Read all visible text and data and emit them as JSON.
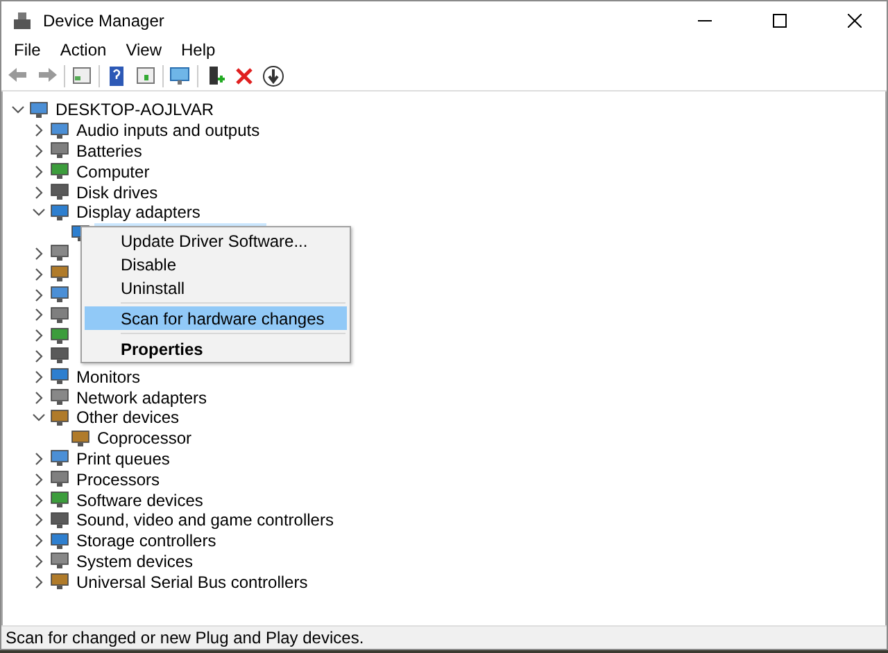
{
  "window": {
    "title": "Device Manager"
  },
  "menu_bar": [
    "File",
    "Action",
    "View",
    "Help"
  ],
  "tree": {
    "label": "DESKTOP-AOJLVAR",
    "expanded": true,
    "children": [
      {
        "label": "Audio inputs and outputs",
        "expanded": false
      },
      {
        "label": "Batteries",
        "expanded": false
      },
      {
        "label": "Computer",
        "expanded": false
      },
      {
        "label": "Disk drives",
        "expanded": false
      },
      {
        "label": "Display adapters",
        "expanded": true,
        "children": [
          {
            "selected": true
          }
        ]
      },
      {
        "expanded": false
      },
      {
        "expanded": false
      },
      {
        "expanded": false
      },
      {
        "expanded": false
      },
      {
        "expanded": false
      },
      {
        "expanded": false
      },
      {
        "label": "Monitors",
        "expanded": false
      },
      {
        "label": "Network adapters",
        "expanded": false
      },
      {
        "label": "Other devices",
        "expanded": true,
        "children": [
          {
            "label": "Coprocessor",
            "selected": false
          }
        ]
      },
      {
        "label": "Print queues",
        "expanded": false
      },
      {
        "label": "Processors",
        "expanded": false
      },
      {
        "label": "Software devices",
        "expanded": false
      },
      {
        "label": "Sound, video and game controllers",
        "expanded": false
      },
      {
        "label": "Storage controllers",
        "expanded": false
      },
      {
        "label": "System devices",
        "expanded": false
      },
      {
        "label": "Universal Serial Bus controllers",
        "expanded": false
      }
    ]
  },
  "context_menu": [
    {
      "kind": "item",
      "label": "Update Driver Software...",
      "selected": false
    },
    {
      "kind": "item",
      "label": "Disable",
      "selected": false
    },
    {
      "kind": "item",
      "label": "Uninstall",
      "selected": false
    },
    {
      "kind": "separator"
    },
    {
      "kind": "item",
      "label": "Scan for hardware changes",
      "selected": true
    },
    {
      "kind": "separator"
    },
    {
      "kind": "default",
      "label": "Properties",
      "selected": false
    }
  ],
  "status_bar": "Scan for changed or new Plug and Play devices."
}
